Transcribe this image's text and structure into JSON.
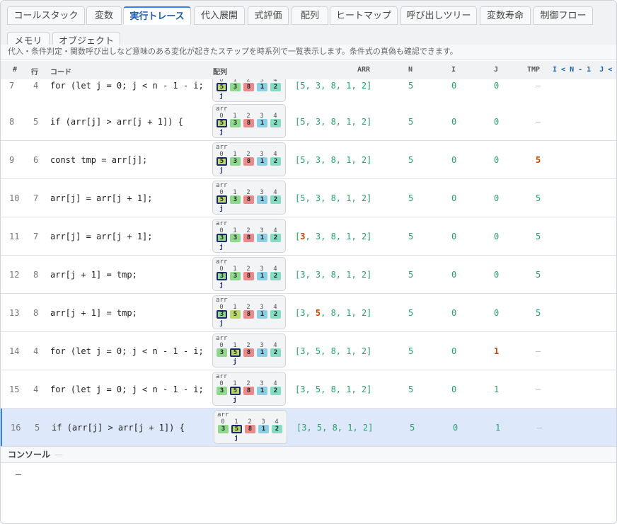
{
  "tabs": [
    {
      "label": "コールスタック",
      "active": false
    },
    {
      "label": "変数",
      "active": false
    },
    {
      "label": "実行トレース",
      "active": true
    },
    {
      "label": "代入展開",
      "active": false
    },
    {
      "label": "式評価",
      "active": false
    },
    {
      "label": "配列",
      "active": false
    },
    {
      "label": "ヒートマップ",
      "active": false
    },
    {
      "label": "呼び出しツリー",
      "active": false
    },
    {
      "label": "変数寿命",
      "active": false
    },
    {
      "label": "制御フロー",
      "active": false
    },
    {
      "label": "メモリ",
      "active": false
    },
    {
      "label": "オブジェクト",
      "active": false
    }
  ],
  "description": "代入・条件判定・関数呼び出しなど意味のある変化が起きたステップを時系列で一覧表示します。条件式の真偽も確認できます。",
  "columns": {
    "step": "#",
    "line": "行",
    "code": "コード",
    "viz": "配列",
    "arr": "ARR",
    "n": "N",
    "i": "I",
    "j": "J",
    "tmp": "TMP",
    "cond": "I < N - 1  J <"
  },
  "viz_label": "arr",
  "pointer_label": "j",
  "indices": [
    "0",
    "1",
    "2",
    "3",
    "4"
  ],
  "colors": {
    "3": "#8fd98f",
    "5": "#b9d86a",
    "8": "#ea8a8a",
    "1": "#8ccfe4",
    "2": "#84dcc2"
  },
  "rows": [
    {
      "step": "7",
      "line": "4",
      "code": "for (let j = 0; j < n - 1 - i;",
      "arr_pre": "[5, 3, 8, 1, 2]",
      "arr_ch": "",
      "arr_post": "",
      "cells": [
        "5",
        "3",
        "8",
        "1",
        "2"
      ],
      "ptr": 0,
      "n": "5",
      "i": "0",
      "j": "0",
      "tmp": "—",
      "n_ch": false,
      "i_ch": false,
      "j_ch": false,
      "tmp_ch": false,
      "tmp_dash": true,
      "selected": false
    },
    {
      "step": "8",
      "line": "5",
      "code": "if (arr[j] > arr[j + 1]) {",
      "arr_pre": "[5, 3, 8, 1, 2]",
      "arr_ch": "",
      "arr_post": "",
      "cells": [
        "5",
        "3",
        "8",
        "1",
        "2"
      ],
      "ptr": 0,
      "n": "5",
      "i": "0",
      "j": "0",
      "tmp": "—",
      "n_ch": false,
      "i_ch": false,
      "j_ch": false,
      "tmp_ch": false,
      "tmp_dash": true,
      "selected": false
    },
    {
      "step": "9",
      "line": "6",
      "code": "const tmp = arr[j];",
      "arr_pre": "[5, 3, 8, 1, 2]",
      "arr_ch": "",
      "arr_post": "",
      "cells": [
        "5",
        "3",
        "8",
        "1",
        "2"
      ],
      "ptr": 0,
      "n": "5",
      "i": "0",
      "j": "0",
      "tmp": "5",
      "n_ch": false,
      "i_ch": false,
      "j_ch": false,
      "tmp_ch": true,
      "tmp_dash": false,
      "selected": false
    },
    {
      "step": "10",
      "line": "7",
      "code": "arr[j] = arr[j + 1];",
      "arr_pre": "[5, 3, 8, 1, 2]",
      "arr_ch": "",
      "arr_post": "",
      "cells": [
        "5",
        "3",
        "8",
        "1",
        "2"
      ],
      "ptr": 0,
      "n": "5",
      "i": "0",
      "j": "0",
      "tmp": "5",
      "n_ch": false,
      "i_ch": false,
      "j_ch": false,
      "tmp_ch": false,
      "tmp_dash": false,
      "selected": false
    },
    {
      "step": "11",
      "line": "7",
      "code": "arr[j] = arr[j + 1];",
      "arr_pre": "[",
      "arr_ch": "3",
      "arr_post": ", 3, 8, 1, 2]",
      "cells": [
        "3",
        "3",
        "8",
        "1",
        "2"
      ],
      "ptr": 0,
      "n": "5",
      "i": "0",
      "j": "0",
      "tmp": "5",
      "n_ch": false,
      "i_ch": false,
      "j_ch": false,
      "tmp_ch": false,
      "tmp_dash": false,
      "selected": false
    },
    {
      "step": "12",
      "line": "8",
      "code": "arr[j + 1] = tmp;",
      "arr_pre": "[3, 3, 8, 1, 2]",
      "arr_ch": "",
      "arr_post": "",
      "cells": [
        "3",
        "3",
        "8",
        "1",
        "2"
      ],
      "ptr": 0,
      "n": "5",
      "i": "0",
      "j": "0",
      "tmp": "5",
      "n_ch": false,
      "i_ch": false,
      "j_ch": false,
      "tmp_ch": false,
      "tmp_dash": false,
      "selected": false
    },
    {
      "step": "13",
      "line": "8",
      "code": "arr[j + 1] = tmp;",
      "arr_pre": "[3, ",
      "arr_ch": "5",
      "arr_post": ", 8, 1, 2]",
      "cells": [
        "3",
        "5",
        "8",
        "1",
        "2"
      ],
      "ptr": 0,
      "n": "5",
      "i": "0",
      "j": "0",
      "tmp": "5",
      "n_ch": false,
      "i_ch": false,
      "j_ch": false,
      "tmp_ch": false,
      "tmp_dash": false,
      "selected": false
    },
    {
      "step": "14",
      "line": "4",
      "code": "for (let j = 0; j < n - 1 - i;",
      "arr_pre": "[3, 5, 8, 1, 2]",
      "arr_ch": "",
      "arr_post": "",
      "cells": [
        "3",
        "5",
        "8",
        "1",
        "2"
      ],
      "ptr": 1,
      "n": "5",
      "i": "0",
      "j": "1",
      "tmp": "—",
      "n_ch": false,
      "i_ch": false,
      "j_ch": true,
      "tmp_ch": false,
      "tmp_dash": true,
      "selected": false
    },
    {
      "step": "15",
      "line": "4",
      "code": "for (let j = 0; j < n - 1 - i;",
      "arr_pre": "[3, 5, 8, 1, 2]",
      "arr_ch": "",
      "arr_post": "",
      "cells": [
        "3",
        "5",
        "8",
        "1",
        "2"
      ],
      "ptr": 1,
      "n": "5",
      "i": "0",
      "j": "1",
      "tmp": "—",
      "n_ch": false,
      "i_ch": false,
      "j_ch": false,
      "tmp_ch": false,
      "tmp_dash": true,
      "selected": false
    },
    {
      "step": "16",
      "line": "5",
      "code": "if (arr[j] > arr[j + 1]) {",
      "arr_pre": "[3, 5, 8, 1, 2]",
      "arr_ch": "",
      "arr_post": "",
      "cells": [
        "3",
        "5",
        "8",
        "1",
        "2"
      ],
      "ptr": 1,
      "n": "5",
      "i": "0",
      "j": "1",
      "tmp": "—",
      "n_ch": false,
      "i_ch": false,
      "j_ch": false,
      "tmp_ch": false,
      "tmp_dash": true,
      "selected": true
    }
  ],
  "console": {
    "title": "コンソール",
    "badge": "—",
    "output": "—"
  }
}
